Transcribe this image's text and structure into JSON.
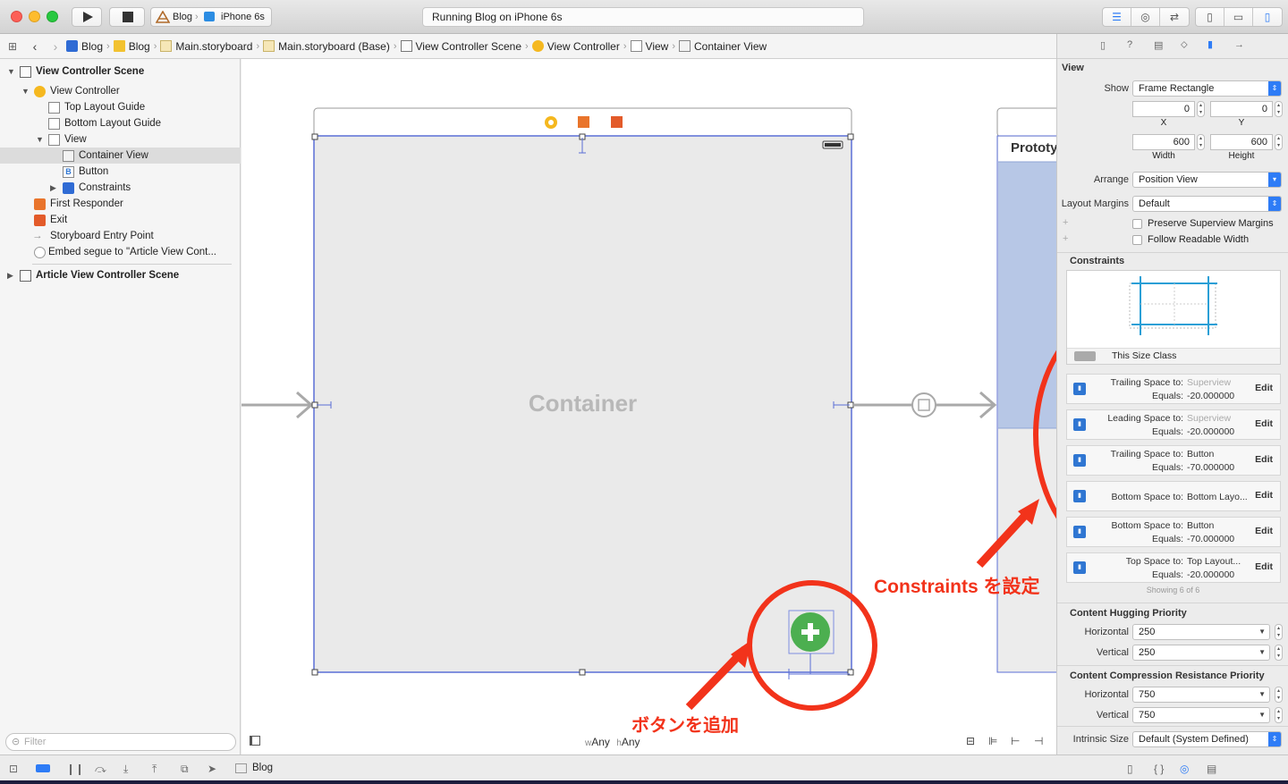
{
  "toolbar": {
    "scheme_project": "Blog",
    "scheme_device": "iPhone 6s",
    "status_text": "Running Blog on iPhone 6s"
  },
  "jumpbar": {
    "items": [
      "Blog",
      "Blog",
      "Main.storyboard",
      "Main.storyboard (Base)",
      "View Controller Scene",
      "View Controller",
      "View",
      "Container View"
    ]
  },
  "outline": {
    "scene1": "View Controller Scene",
    "view_controller": "View Controller",
    "top_layout_guide": "Top Layout Guide",
    "bottom_layout_guide": "Bottom Layout Guide",
    "view": "View",
    "container_view": "Container View",
    "button": "Button",
    "constraints": "Constraints",
    "first_responder": "First Responder",
    "exit": "Exit",
    "storyboard_entry_point": "Storyboard Entry Point",
    "embed_segue": "Embed segue to \"Article View Cont...",
    "scene2": "Article View Controller Scene",
    "filter_placeholder": "Filter"
  },
  "canvas": {
    "container_label": "Container",
    "proto_label": "Prototy",
    "size_w_prefix": "w",
    "size_w": "Any",
    "size_h_prefix": "h",
    "size_h": "Any",
    "annotation_add_button": "ボタンを追加",
    "annotation_constraints": "Constraints を設定"
  },
  "inspector": {
    "view_header": "View",
    "show_label": "Show",
    "show_value": "Frame Rectangle",
    "x_value": "0",
    "y_value": "0",
    "x_label": "X",
    "y_label": "Y",
    "width_value": "600",
    "height_value": "600",
    "width_label": "Width",
    "height_label": "Height",
    "arrange_label": "Arrange",
    "arrange_value": "Position View",
    "layout_margins_label": "Layout Margins",
    "layout_margins_value": "Default",
    "preserve_label": "Preserve Superview Margins",
    "follow_label": "Follow Readable Width",
    "constraints_header": "Constraints",
    "size_class_label": "This Size Class",
    "constraints": [
      {
        "title": "Trailing Space to:",
        "target": "Superview",
        "equals_label": "Equals:",
        "equals": "-20.000000",
        "edit": "Edit",
        "dim": true
      },
      {
        "title": "Leading Space to:",
        "target": "Superview",
        "equals_label": "Equals:",
        "equals": "-20.000000",
        "edit": "Edit",
        "dim": true
      },
      {
        "title": "Trailing Space to:",
        "target": "Button",
        "equals_label": "Equals:",
        "equals": "-70.000000",
        "edit": "Edit",
        "dim": false
      },
      {
        "title": "Bottom Space to:",
        "target": "Bottom Layo...",
        "equals_label": "",
        "equals": "",
        "edit": "Edit",
        "dim": false
      },
      {
        "title": "Bottom Space to:",
        "target": "Button",
        "equals_label": "Equals:",
        "equals": "-70.000000",
        "edit": "Edit",
        "dim": false
      },
      {
        "title": "Top Space to:",
        "target": "Top Layout...",
        "equals_label": "Equals:",
        "equals": "-20.000000",
        "edit": "Edit",
        "dim": false
      }
    ],
    "showing_label": "Showing 6 of 6",
    "hugging_header": "Content Hugging Priority",
    "hug_h_label": "Horizontal",
    "hug_h_value": "250",
    "hug_v_label": "Vertical",
    "hug_v_value": "250",
    "compression_header": "Content Compression Resistance Priority",
    "comp_h_label": "Horizontal",
    "comp_h_value": "750",
    "comp_v_label": "Vertical",
    "comp_v_value": "750",
    "intrinsic_label": "Intrinsic Size",
    "intrinsic_value": "Default (System Defined)"
  },
  "bottombar": {
    "target": "Blog"
  },
  "colors": {
    "accent": "#2e7cf6",
    "annotation": "#f2331b",
    "button_green": "#4caf50",
    "selection_blue": "#5b6fd6"
  }
}
